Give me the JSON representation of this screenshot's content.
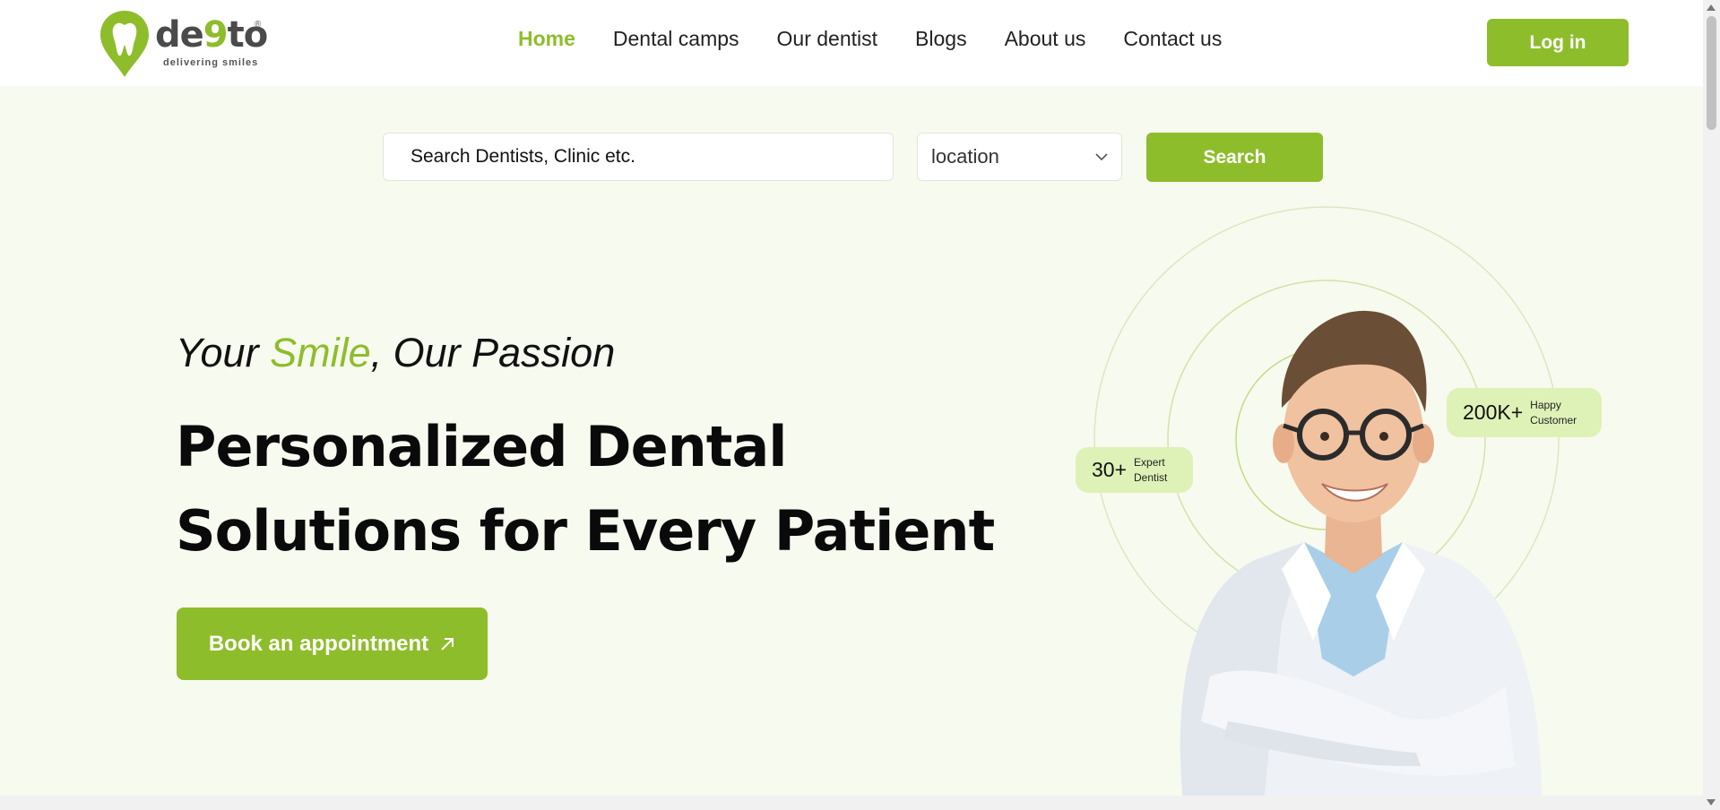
{
  "brand": {
    "name_prefix": "de",
    "name_nine": "9",
    "name_suffix": "to",
    "registered_mark": "®",
    "tagline": "delivering smiles",
    "color": "#8ebd2b"
  },
  "nav": {
    "items": [
      {
        "label": "Home",
        "active": true
      },
      {
        "label": "Dental camps"
      },
      {
        "label": "Our dentist"
      },
      {
        "label": "Blogs"
      },
      {
        "label": "About us"
      },
      {
        "label": "Contact us"
      }
    ],
    "login_label": "Log in"
  },
  "search": {
    "placeholder": "Search Dentists, Clinic etc.",
    "location_value": "location",
    "button_label": "Search"
  },
  "hero": {
    "tagline_before": "Your ",
    "tagline_accent": "Smile",
    "tagline_after": ", Our Passion",
    "headline_line1": "Personalized Dental",
    "headline_line2": "Solutions for Every Patient",
    "cta_label": "Book an appointment"
  },
  "stats": [
    {
      "number": "30+",
      "label_line1": "Expert",
      "label_line2": "Dentist"
    },
    {
      "number": "200K+",
      "label_line1": "Happy",
      "label_line2": "Customer"
    }
  ],
  "icons": {
    "logo": "tooth-pin-icon",
    "dropdown": "chevron-down-icon",
    "cta": "arrow-up-right-icon"
  }
}
